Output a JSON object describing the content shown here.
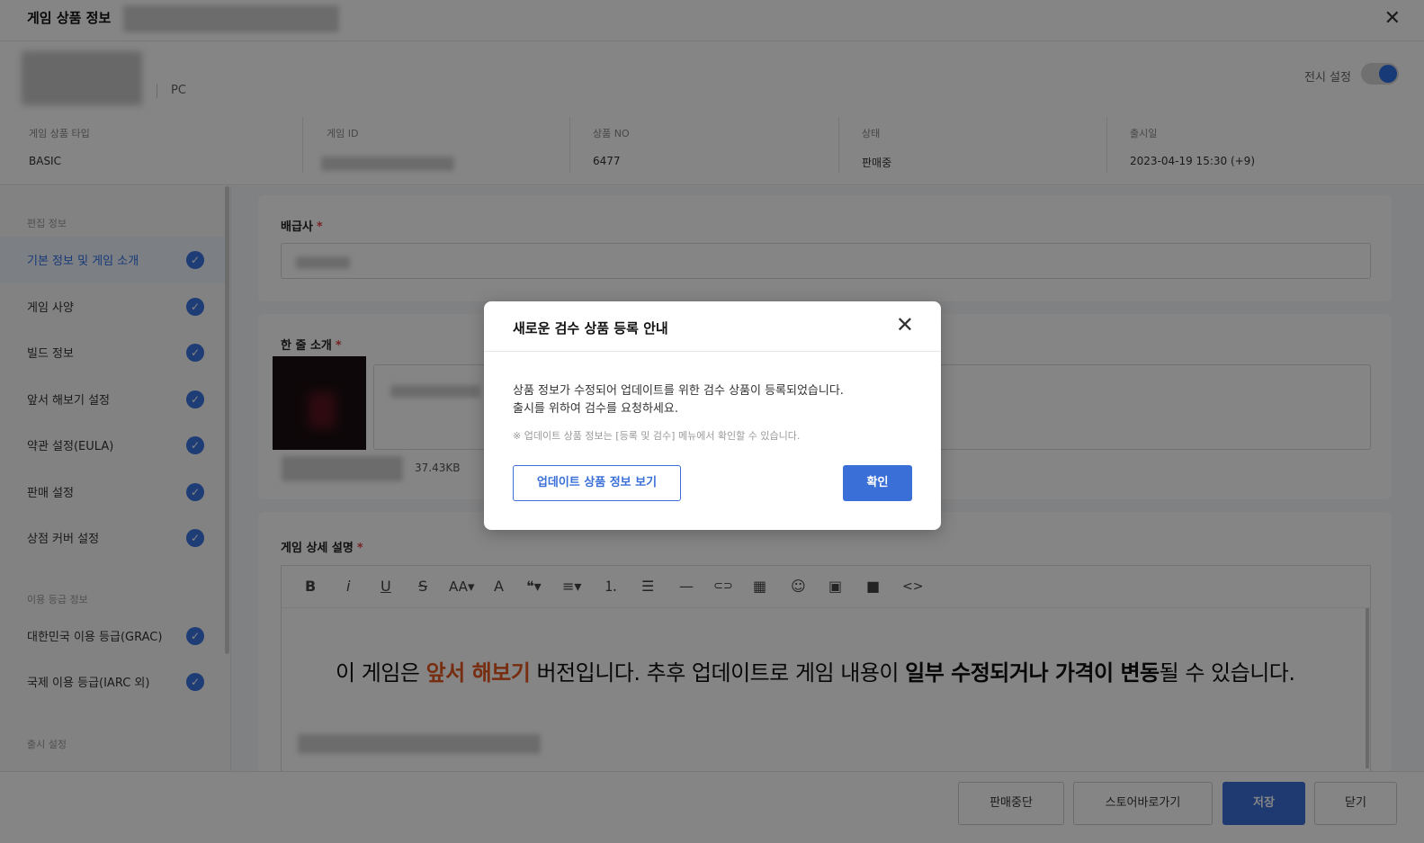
{
  "header": {
    "title": "게임 상품 정보",
    "close_icon": "✕"
  },
  "game": {
    "platform": "PC",
    "display_label": "전시 설정",
    "display_on": true
  },
  "meta": [
    {
      "label": "게임 상품 타입",
      "value": "BASIC"
    },
    {
      "label": "게임 ID",
      "value": ""
    },
    {
      "label": "상품 NO",
      "value": "6477"
    },
    {
      "label": "상태",
      "value": "판매중"
    },
    {
      "label": "출시일",
      "value": "2023-04-19 15:30 (+9)"
    }
  ],
  "sidebar": {
    "sections": [
      "편집 정보",
      "이용 등급 정보",
      "출시 설정"
    ],
    "items": [
      {
        "label": "기본 정보 및 게임 소개",
        "active": true
      },
      {
        "label": "게임 사양"
      },
      {
        "label": "빌드 정보"
      },
      {
        "label": "앞서 해보기 설정"
      },
      {
        "label": "약관 설정(EULA)"
      },
      {
        "label": "판매 설정"
      },
      {
        "label": "상점 커버 설정"
      },
      {
        "label": "대한민국 이용 등급(GRAC)"
      },
      {
        "label": "국제 이용 등급(IARC 외)"
      }
    ],
    "check_icon": "✓"
  },
  "main": {
    "publisher": {
      "label": "배급사",
      "required": "*"
    },
    "oneline": {
      "label": "한 줄 소개",
      "required": "*",
      "file_size": "37.43KB"
    },
    "detail": {
      "label": "게임 상세 설명",
      "required": "*"
    }
  },
  "editor": {
    "toolbar": [
      {
        "icon": "bold-icon",
        "glyph": "B"
      },
      {
        "icon": "italic-icon",
        "glyph": "i"
      },
      {
        "icon": "underline-icon",
        "glyph": "U"
      },
      {
        "icon": "strikethrough-icon",
        "glyph": "S"
      },
      {
        "icon": "font-size-icon",
        "glyph": "AA▾"
      },
      {
        "icon": "font-color-icon",
        "glyph": "A"
      },
      {
        "icon": "blockquote-icon",
        "glyph": "❝▾"
      },
      {
        "icon": "align-icon",
        "glyph": "≡▾"
      },
      {
        "icon": "ordered-list-icon",
        "glyph": "⒈"
      },
      {
        "icon": "bullet-list-icon",
        "glyph": "☰"
      },
      {
        "icon": "horizontal-rule-icon",
        "glyph": "—"
      },
      {
        "icon": "link-icon",
        "glyph": "⊂⊃"
      },
      {
        "icon": "table-icon",
        "glyph": "▦"
      },
      {
        "icon": "emoji-icon",
        "glyph": "☺"
      },
      {
        "icon": "image-icon",
        "glyph": "▣"
      },
      {
        "icon": "video-icon",
        "glyph": "■"
      },
      {
        "icon": "code-view-icon",
        "glyph": "<>"
      }
    ],
    "banner": {
      "part1": "이 게임은 ",
      "highlight": "앞서 해보기",
      "part2": " 버전입니다. 추후 업데이트로 게임 내용이 ",
      "bold": "일부 수정되거나 가격이 변동",
      "part3": "될 수 있습니다."
    }
  },
  "footer": {
    "stop_sale": "판매중단",
    "store_shortcut": "스토어바로가기",
    "save": "저장",
    "close": "닫기"
  },
  "modal": {
    "title": "새로운 검수 상품 등록 안내",
    "close_icon": "✕",
    "line1": "상품 정보가 수정되어 업데이트를 위한 검수 상품이 등록되었습니다.",
    "line2": "출시를 위하여 검수를 요청하세요.",
    "note": "※ 업데이트 상품 정보는 [등록 및 검수] 메뉴에서 확인할 수 있습니다.",
    "view_button": "업데이트 상품 정보 보기",
    "ok_button": "확인"
  },
  "colors": {
    "accent": "#3a6fd8",
    "highlight": "#e4571f",
    "overlay": "rgba(0,0,0,0.48)"
  }
}
